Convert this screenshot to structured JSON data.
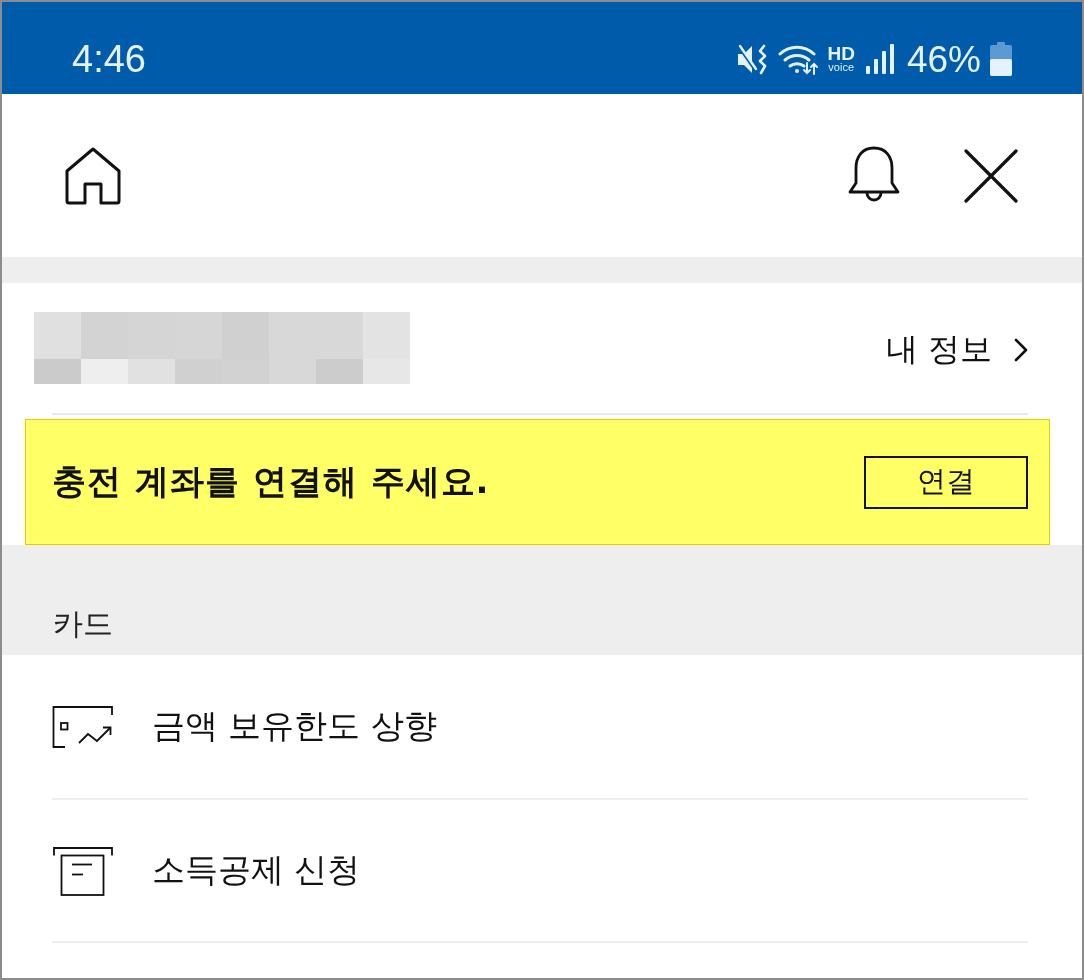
{
  "status_bar": {
    "time": "4:46",
    "hd_label": "HD",
    "voice_label": "voice",
    "battery_percent": "46%"
  },
  "profile": {
    "link_label": "내 정보"
  },
  "banner": {
    "message": "충전 계좌를 연결해 주세요.",
    "button_label": "연결"
  },
  "card_section": {
    "title": "카드",
    "items": [
      {
        "kind": "limit",
        "label": "금액 보유한도 상향"
      },
      {
        "kind": "receipt",
        "label": "소득공제 신청"
      }
    ]
  }
}
